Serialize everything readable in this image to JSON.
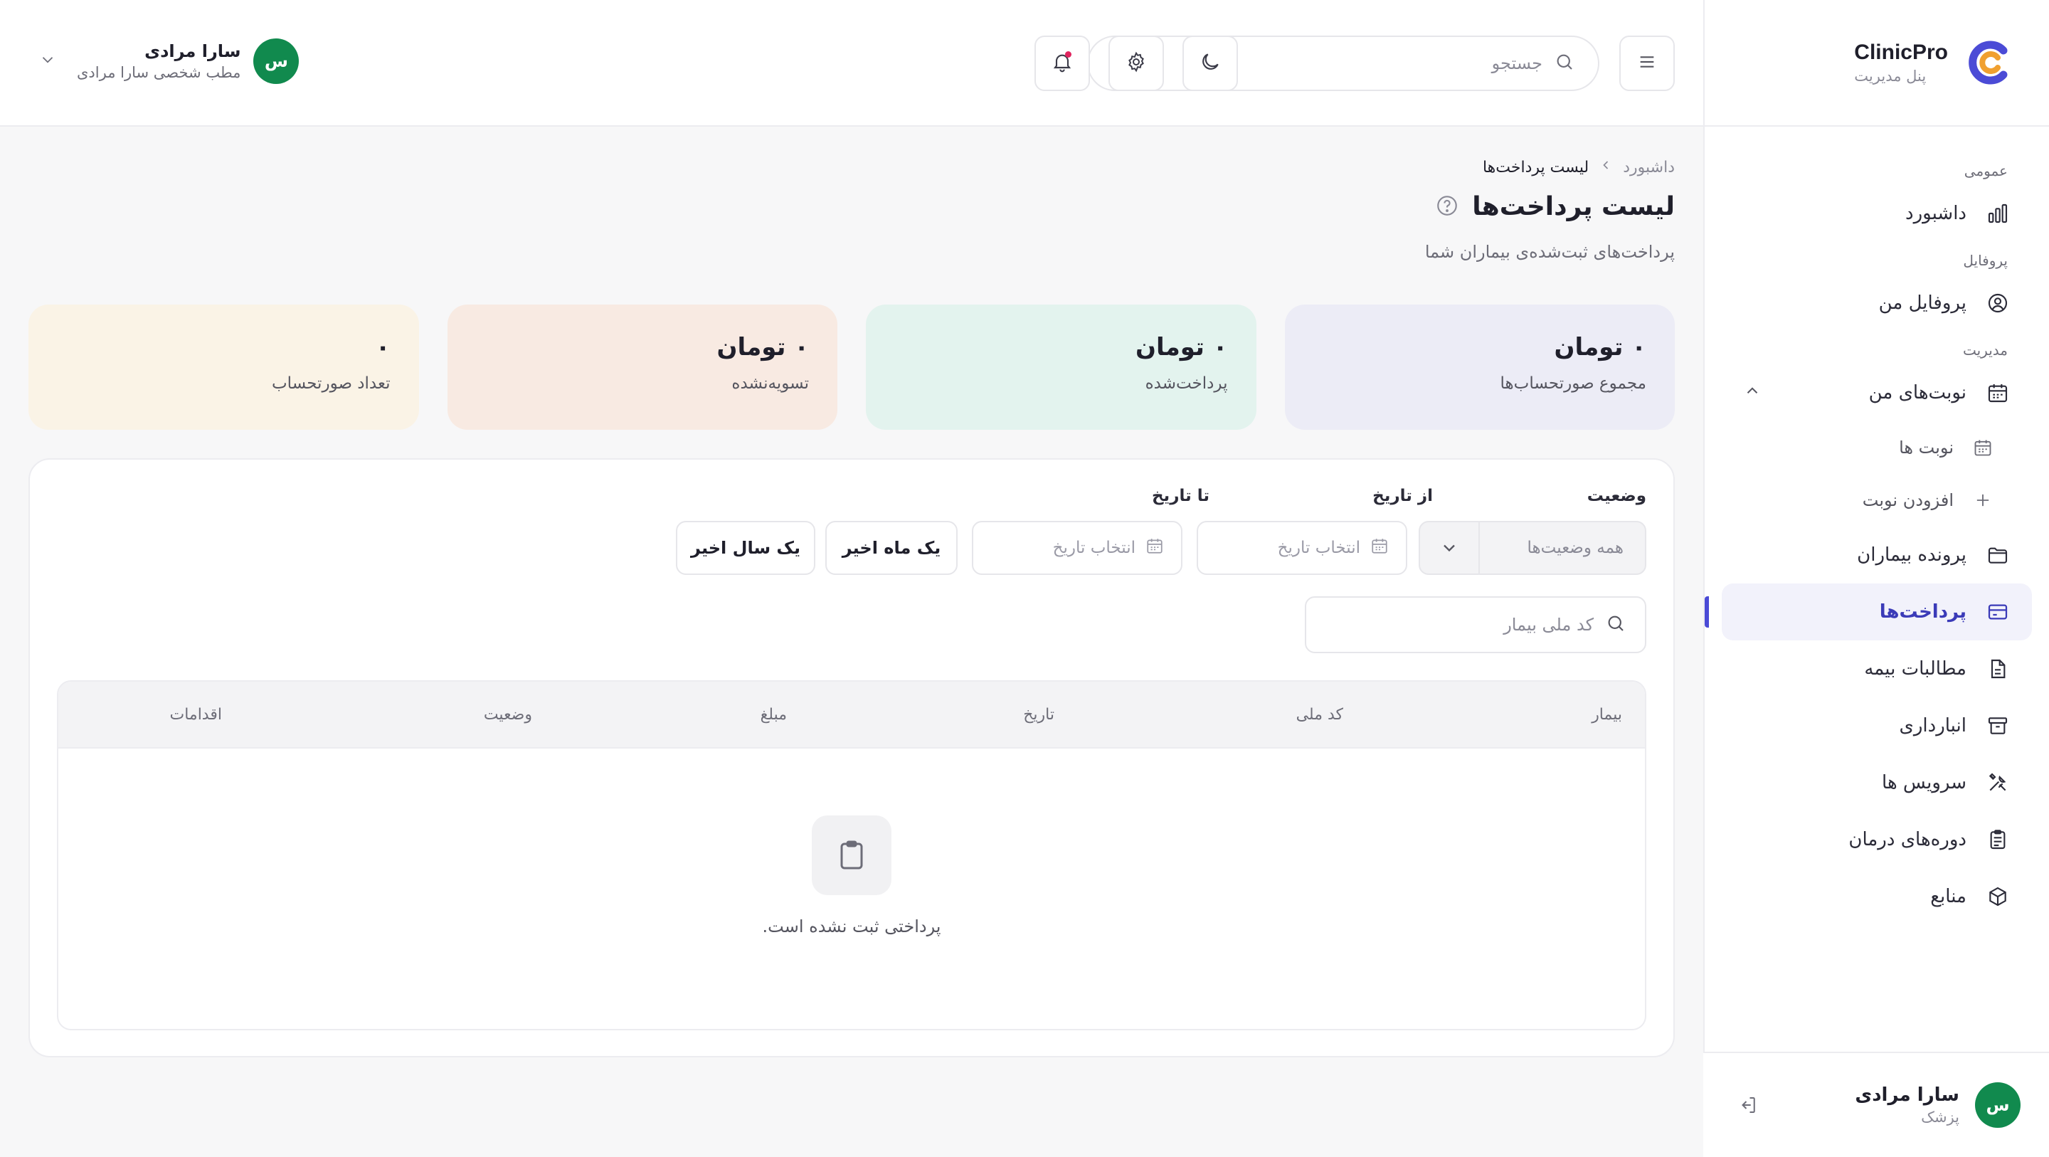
{
  "brand": {
    "name": "ClinicPro",
    "subtitle": "پنل مدیریت"
  },
  "sidebar": {
    "sections": [
      "عمومی",
      "پروفایل",
      "مدیریت"
    ],
    "items": [
      {
        "label": "داشبورد",
        "icon": "chart-bar-icon"
      },
      {
        "label": "پروفایل من",
        "icon": "user-circle-icon"
      },
      {
        "label": "نوبت‌های من",
        "icon": "calendar-icon"
      },
      {
        "label": "نوبت ها",
        "icon": "calendar-icon"
      },
      {
        "label": "افزودن نوبت",
        "icon": "plus-icon"
      },
      {
        "label": "پرونده بیماران",
        "icon": "folder-icon"
      },
      {
        "label": "پرداخت‌ها",
        "icon": "credit-card-icon"
      },
      {
        "label": "مطالبات بیمه",
        "icon": "document-icon"
      },
      {
        "label": "انبارداری",
        "icon": "archive-icon"
      },
      {
        "label": "سرویس ها",
        "icon": "tools-icon"
      },
      {
        "label": "دوره‌های درمان",
        "icon": "clipboard-list-icon"
      },
      {
        "label": "منابع",
        "icon": "cube-icon"
      }
    ],
    "user": {
      "initial": "س",
      "name": "سارا مرادی",
      "role": "پزشک"
    }
  },
  "header": {
    "search_placeholder": "جستجو",
    "user": {
      "initial": "س",
      "name": "سارا مرادی",
      "subtitle": "مطب شخصی سارا مرادی"
    }
  },
  "page": {
    "breadcrumb": {
      "home": "داشبورد",
      "current": "لیست پرداخت‌ها"
    },
    "title": "لیست پرداخت‌ها",
    "subtitle": "پرداخت‌های ثبت‌شده‌ی بیماران شما"
  },
  "cards": [
    {
      "value": "۰ تومان",
      "label": "مجموع صورتحساب‌ها",
      "color": "#ececf6"
    },
    {
      "value": "۰ تومان",
      "label": "پرداخت‌شده",
      "color": "#e3f3ee"
    },
    {
      "value": "۰ تومان",
      "label": "تسویه‌نشده",
      "color": "#f8eae2"
    },
    {
      "value": "۰",
      "label": "تعداد صورتحساب",
      "color": "#faf3e6"
    }
  ],
  "filters": {
    "status_label": "وضعیت",
    "status_value": "همه وضعیت‌ها",
    "from_label": "از تاریخ",
    "from_placeholder": "انتخاب تاریخ",
    "to_label": "تا تاریخ",
    "to_placeholder": "انتخاب تاریخ",
    "last_month": "یک ماه اخیر",
    "last_year": "یک سال اخیر",
    "nid_placeholder": "کد ملی بیمار"
  },
  "table": {
    "columns": [
      "بیمار",
      "کد ملی",
      "تاریخ",
      "مبلغ",
      "وضعیت",
      "اقدامات"
    ],
    "empty_text": "پرداختی ثبت نشده است."
  },
  "colors": {
    "accent": "#4b4bd6",
    "avatar": "#118a4e",
    "notification": "#e0245e"
  }
}
